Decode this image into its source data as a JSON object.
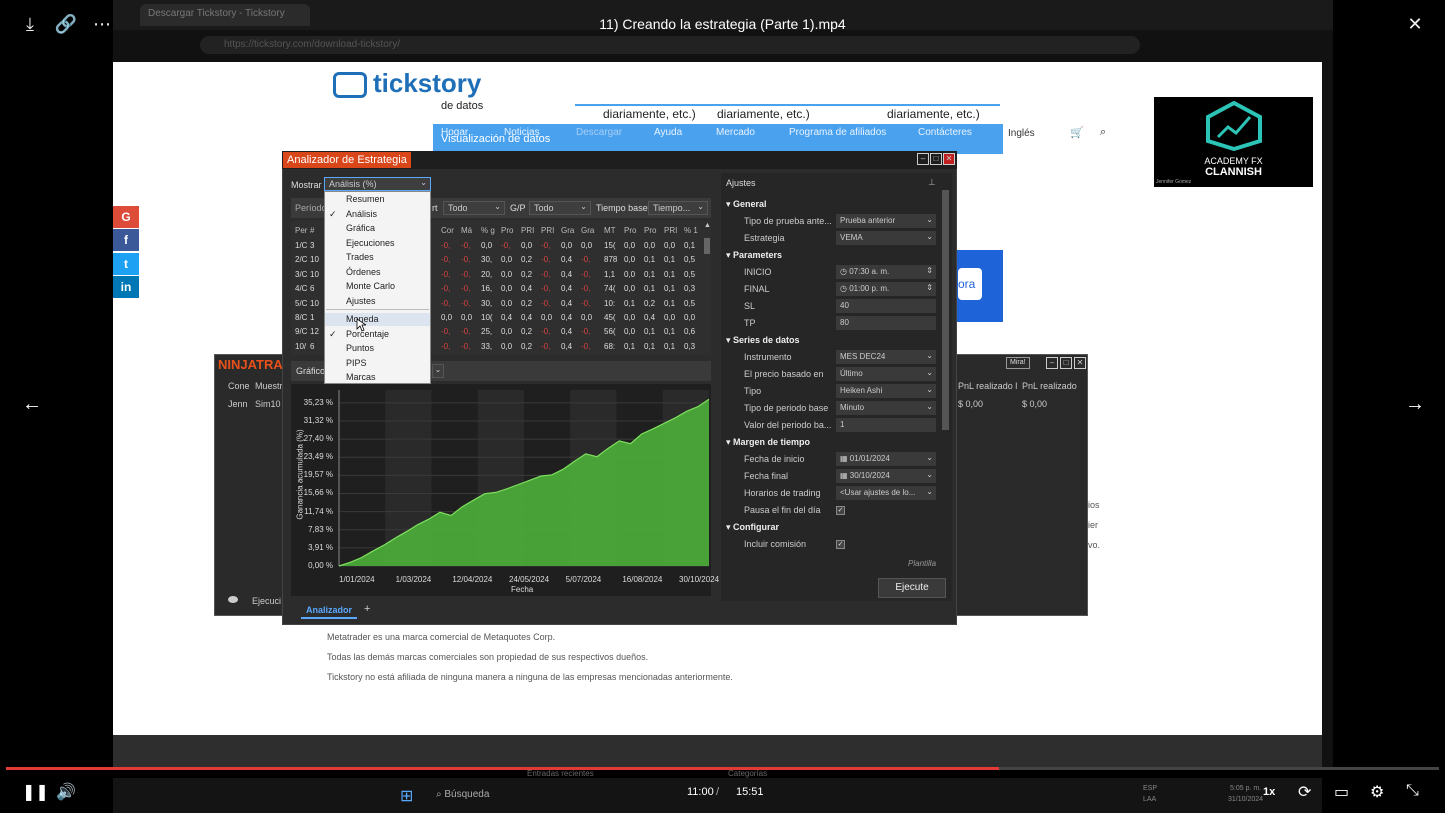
{
  "player": {
    "title": "11) Creando la estrategia (Parte 1).mp4",
    "current_time": "11:00",
    "duration": "15:51",
    "speed": "1x",
    "progress": 0.693
  },
  "browser": {
    "tab_title": "Descargar Tickstory - Tickstory",
    "url": "https://tickstory.com/download-tickstory/"
  },
  "site": {
    "logo_text": "tickstory",
    "partial_text": "de datos",
    "col_texts": [
      "diariamente, etc.)",
      "diariamente, etc.)",
      "diariamente, etc.)"
    ],
    "nav": [
      "Hogar",
      "Noticias",
      "Descargar",
      "Ayuda",
      "Mercado",
      "Programa de afiliados",
      "Contácteres"
    ],
    "visualization_label": "Visualización de datos",
    "lang": "Inglés",
    "blue_button_text": "ora",
    "academy_line1": "ACADEMY FX",
    "academy_line2": "CLANNISH",
    "academy_author": "Jennifer Gomez",
    "footer_lines": [
      "Metatrader es una marca comercial de Metaquotes Corp.",
      "Todas las demás marcas comerciales son propiedad de sus respectivos dueños.",
      "Tickstory no está afiliada de ninguna manera a ninguna de las empresas mencionadas anteriormente."
    ],
    "side_texts": [
      "ios",
      "ier",
      "vo."
    ],
    "footer_bar": [
      "Entradas recientes",
      "Categorías"
    ],
    "social": [
      {
        "label": "G",
        "color": "#dd4b39"
      },
      {
        "label": "f",
        "color": "#3b5998"
      },
      {
        "label": "t",
        "color": "#1da1f2"
      },
      {
        "label": "in",
        "color": "#0077b5"
      }
    ]
  },
  "ninjatrader": {
    "title": "NINJATRA",
    "mira_label": "Mira!",
    "col1": "Cone",
    "col2": "Muestr",
    "row1": "Jenn",
    "row2": "Sim10",
    "col_pnl1": "PnL realizado l",
    "col_pnl2": "PnL realizado",
    "val_pnl1": "$ 0,00",
    "val_pnl2": "$ 0,00",
    "bottom_label": "Ejecuci"
  },
  "analyzer": {
    "title": "Analizador de Estrategia",
    "show_label": "Mostrar",
    "show_value": "Análisis (%)",
    "periodo_label": "Período",
    "filter1_label": "rt",
    "filter1_value": "Todo",
    "filter2_label": "G/P",
    "filter2_value": "Todo",
    "base_label": "Tiempo base",
    "base_value": "Tiempo...",
    "grafico_label": "Gráfico",
    "tab_label": "Analizador",
    "tab_add": "+",
    "grid_headers": [
      "Per",
      "#",
      "Cor",
      "Má",
      "% g",
      "Pro",
      "PRI",
      "PRI",
      "Gra",
      "Gra",
      "MT",
      "Pro",
      "Pro",
      "PRI",
      "% 1"
    ],
    "grid_rows": [
      [
        "1/C",
        "3",
        "-0,",
        "-0,",
        "0,0",
        "-0,",
        "0,0",
        "-0,",
        "0,0",
        "0,0",
        "15(",
        "0,0",
        "0,0",
        "0,0",
        "0,1"
      ],
      [
        "2/C",
        "10",
        "-0,",
        "-0,",
        "30,",
        "0,0",
        "0,2",
        "-0,",
        "0,4",
        "-0,",
        "878",
        "0,0",
        "0,1",
        "0,1",
        "0,5"
      ],
      [
        "3/C",
        "10",
        "-0,",
        "-0,",
        "20,",
        "0,0",
        "0,2",
        "-0,",
        "0,4",
        "-0,",
        "1,1",
        "0,0",
        "0,1",
        "0,1",
        "0,5"
      ],
      [
        "4/C",
        "6",
        "-0,",
        "-0,",
        "16,",
        "0,0",
        "0,4",
        "-0,",
        "0,4",
        "-0,",
        "74(",
        "0,0",
        "0,1",
        "0,1",
        "0,3"
      ],
      [
        "5/C",
        "10",
        "-0,",
        "-0,",
        "30,",
        "0,0",
        "0,2",
        "-0,",
        "0,4",
        "-0,",
        "10:",
        "0,1",
        "0,2",
        "0,1",
        "0,5"
      ],
      [
        "8/C",
        "1",
        "0,0",
        "0,0",
        "10(",
        "0,4",
        "0,4",
        "0,0",
        "0,4",
        "0,0",
        "45(",
        "0,0",
        "0,4",
        "0,0",
        "0,0"
      ],
      [
        "9/C",
        "12",
        "-0,",
        "-0,",
        "25,",
        "0,0",
        "0,2",
        "-0,",
        "0,4",
        "-0,",
        "56(",
        "0,0",
        "0,1",
        "0,1",
        "0,6"
      ],
      [
        "10/",
        "6",
        "-0,",
        "-0,",
        "33,",
        "0,0",
        "0,2",
        "-0,",
        "0,4",
        "-0,",
        "68:",
        "0,1",
        "0,1",
        "0,1",
        "0,3"
      ]
    ],
    "menu": {
      "group1": [
        "Resumen",
        "Análisis",
        "Gráfica",
        "Ejecuciones",
        "Trades",
        "Órdenes",
        "Monte Carlo",
        "Ajustes"
      ],
      "group1_checked": "Análisis",
      "group2": [
        "Moneda",
        "Porcentaje",
        "Puntos",
        "PIPS",
        "Marcas"
      ],
      "group2_checked": "Porcentaje",
      "hovered": "Moneda"
    }
  },
  "chart_data": {
    "type": "area",
    "title": "",
    "xlabel": "Fecha",
    "ylabel": "Ganancia acumulada (%)",
    "y_ticks": [
      "35,23 %",
      "31,32 %",
      "27,40 %",
      "23,49 %",
      "19,57 %",
      "15,66 %",
      "11,74 %",
      "7,83 %",
      "3,91 %",
      "0,00 %"
    ],
    "x_ticks": [
      "1/01/2024",
      "1/03/2024",
      "12/04/2024",
      "24/05/2024",
      "5/07/2024",
      "16/08/2024",
      "30/10/2024"
    ],
    "ylim": [
      0,
      38
    ],
    "series": [
      {
        "values": [
          0,
          0.8,
          1.8,
          3.2,
          4.5,
          6.0,
          7.4,
          8.9,
          10.1,
          11.6,
          10.9,
          12.8,
          14.2,
          15.6,
          15.9,
          16.7,
          17.6,
          18.5,
          19.4,
          19.7,
          20.9,
          22.6,
          24.2,
          23.6,
          25.4,
          27.0,
          26.4,
          28.5,
          29.6,
          30.8,
          32.0,
          33.4,
          34.4,
          36.0
        ]
      }
    ],
    "fill_color": "#4caf3a"
  },
  "settings": {
    "header": "Ajustes",
    "template_label": "Plantilla",
    "run_button": "Ejecute",
    "sections": [
      {
        "title": "General",
        "rows": [
          {
            "label": "Tipo de prueba ante...",
            "value": "Prueba anterior",
            "kind": "dropdown"
          },
          {
            "label": "Estrategia",
            "value": "VEMA",
            "kind": "dropdown"
          }
        ]
      },
      {
        "title": "Parameters",
        "rows": [
          {
            "label": "INICIO",
            "value": "07:30 a. m.",
            "kind": "time"
          },
          {
            "label": "FINAL",
            "value": "01:00 p. m.",
            "kind": "time"
          },
          {
            "label": "SL",
            "value": "40",
            "kind": "text"
          },
          {
            "label": "TP",
            "value": "80",
            "kind": "text"
          }
        ]
      },
      {
        "title": "Series de datos",
        "rows": [
          {
            "label": "Instrumento",
            "value": "MES DEC24",
            "kind": "dropdown"
          },
          {
            "label": "El precio basado en",
            "value": "Último",
            "kind": "dropdown"
          },
          {
            "label": "Tipo",
            "value": "Heiken Ashi",
            "kind": "dropdown"
          },
          {
            "label": "Tipo de periodo base",
            "value": "Minuto",
            "kind": "dropdown"
          },
          {
            "label": "Valor del periodo ba...",
            "value": "1",
            "kind": "text"
          }
        ]
      },
      {
        "title": "Margen de tiempo",
        "rows": [
          {
            "label": "Fecha de inicio",
            "value": "01/01/2024",
            "kind": "date"
          },
          {
            "label": "Fecha final",
            "value": "30/10/2024",
            "kind": "date"
          },
          {
            "label": "Horarios de trading",
            "value": "<Usar ajustes de lo...",
            "kind": "dropdown"
          },
          {
            "label": "Pausa el fin del día",
            "value": "✓",
            "kind": "check"
          }
        ]
      },
      {
        "title": "Configurar",
        "rows": [
          {
            "label": "Incluir comisión",
            "value": "✓",
            "kind": "check"
          }
        ]
      }
    ]
  },
  "taskbar": {
    "search": "Búsqueda",
    "lang": "ESP",
    "lang2": "LAA",
    "clock": "5:05 p. m.",
    "date": "31/10/2024"
  }
}
